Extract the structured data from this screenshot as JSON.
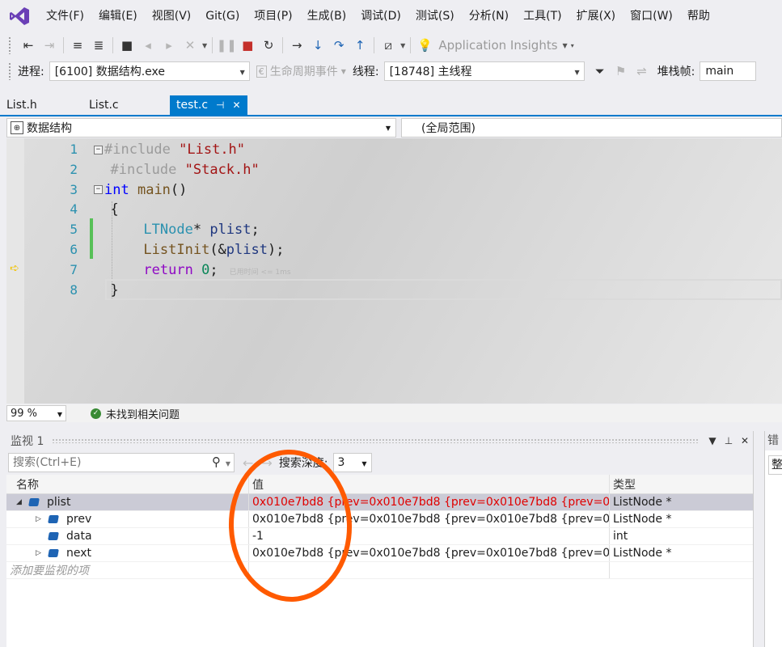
{
  "menubar": {
    "items": [
      "文件(F)",
      "编辑(E)",
      "视图(V)",
      "Git(G)",
      "项目(P)",
      "生成(B)",
      "调试(D)",
      "测试(S)",
      "分析(N)",
      "工具(T)",
      "扩展(X)",
      "窗口(W)",
      "帮助"
    ]
  },
  "toolbar1": {
    "app_insights_label": "Application Insights"
  },
  "toolbar2": {
    "process_label": "进程:",
    "process_value": "[6100] 数据结构.exe",
    "lifecycle_label": "生命周期事件",
    "thread_label": "线程:",
    "thread_value": "[18748] 主线程",
    "stackframe_label": "堆栈帧:",
    "stackframe_value": "main"
  },
  "tabs": [
    {
      "label": "List.h"
    },
    {
      "label": "List.c"
    },
    {
      "label": "test.c",
      "active": true
    }
  ],
  "navbar": {
    "project": "数据结构",
    "scope": "(全局范围)"
  },
  "editor": {
    "line_numbers": [
      "1",
      "2",
      "3",
      "4",
      "5",
      "6",
      "7",
      "8"
    ],
    "code": {
      "l1_dir": "#include",
      "l1_str": "\"List.h\"",
      "l2_dir": "#include",
      "l2_str": "\"Stack.h\"",
      "l3_kw": "int",
      "l3_fn": "main",
      "l3_punc": "()",
      "l4": "{",
      "l5_type": "LTNode",
      "l5_rest": "* ",
      "l5_var": "plist",
      "l5_end": ";",
      "l6_fn": "ListInit",
      "l6_open": "(&",
      "l6_var": "plist",
      "l6_end": ");",
      "l7_kw": "return",
      "l7_num": "0",
      "l7_end": ";",
      "l7_hint": "已用时间 <= 1ms",
      "l8": "}"
    },
    "exec_line": 7
  },
  "editor_status": {
    "zoom": "99 %",
    "issues": "未找到相关问题"
  },
  "watch": {
    "title": "监视 1",
    "search_placeholder": "搜索(Ctrl+E)",
    "depth_label": "搜索深度:",
    "depth_value": "3",
    "columns": {
      "name": "名称",
      "value": "值",
      "type": "类型"
    },
    "rows": [
      {
        "name": "plist",
        "value": "0x010e7bd8 {prev=0x010e7bd8 {prev=0x010e7bd8 {prev=0x010...",
        "type": "ListNode *",
        "expanded": true
      },
      {
        "name": "prev",
        "value": "0x010e7bd8 {prev=0x010e7bd8 {prev=0x010e7bd8 {prev=0x010...",
        "type": "ListNode *"
      },
      {
        "name": "data",
        "value": "-1",
        "type": "int"
      },
      {
        "name": "next",
        "value": "0x010e7bd8 {prev=0x010e7bd8 {prev=0x010e7bd8 {prev=0x010...",
        "type": "ListNode *"
      }
    ],
    "add_item_label": "添加要监视的项"
  },
  "side_panel": {
    "title": "错",
    "box": "整"
  },
  "colors": {
    "accent": "#007acc",
    "annotation": "#ff5a00",
    "changed_value": "#e00000"
  }
}
